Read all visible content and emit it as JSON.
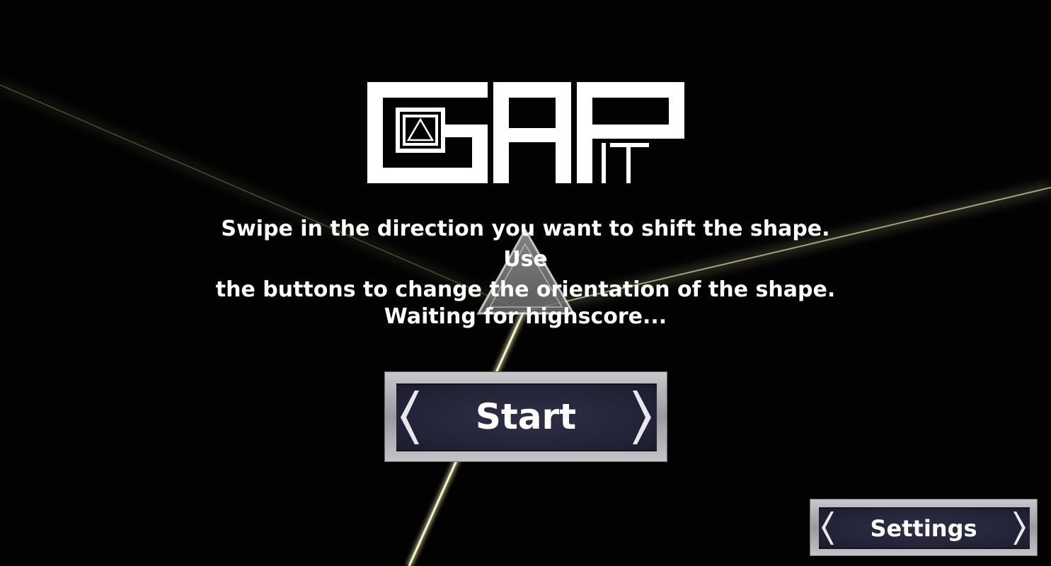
{
  "logo": {
    "icon": "gap-it-logo",
    "text": "GAP IT"
  },
  "instructions": {
    "line1": "Swipe in the direction you want to shift the shape. Use",
    "line2": "the buttons to change the orientation of the shape."
  },
  "highscore_status": "Waiting for highscore...",
  "buttons": {
    "start_label": "Start",
    "settings_label": "Settings"
  },
  "colors": {
    "background": "#000000",
    "text": "#ffffff",
    "button_face": "#262638",
    "button_frame": "#b4b4ba",
    "beam": "#e8e4a8"
  }
}
